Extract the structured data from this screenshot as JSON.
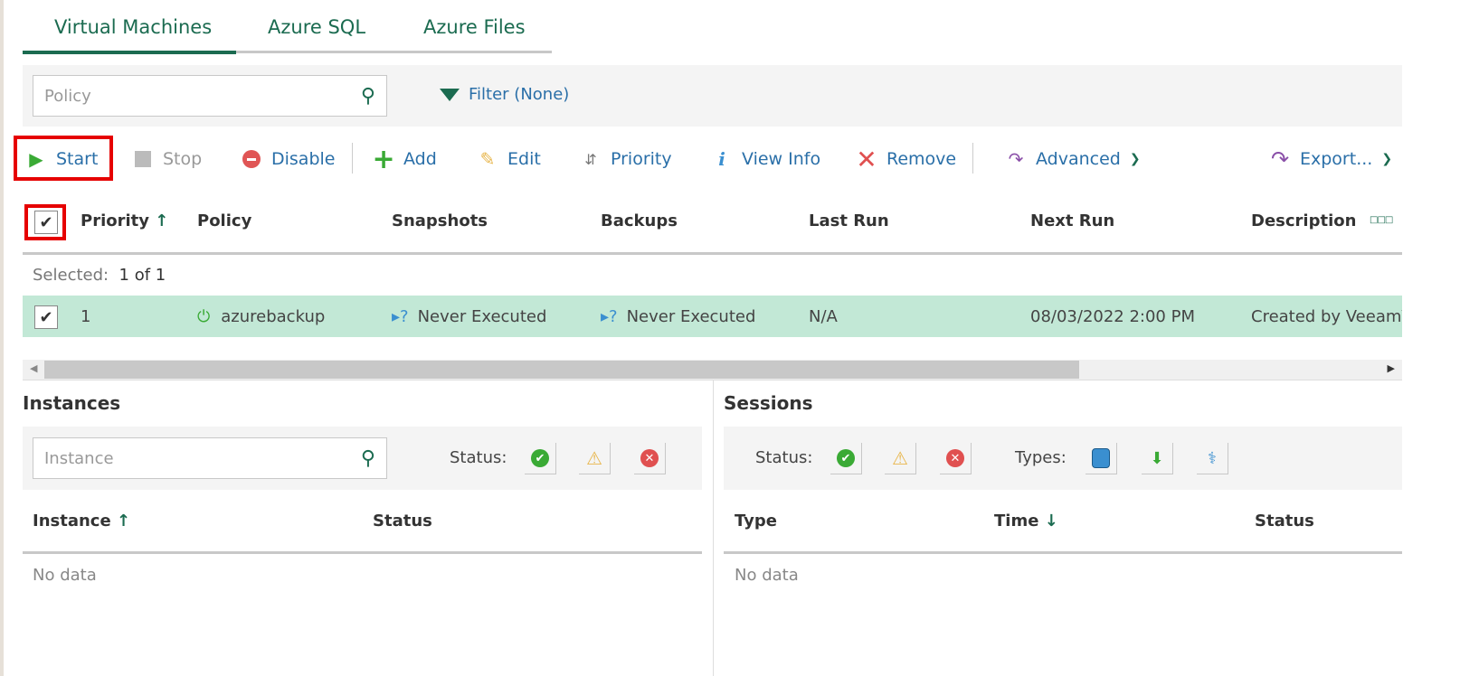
{
  "tabs": [
    {
      "label": "Virtual Machines",
      "active": true
    },
    {
      "label": "Azure SQL"
    },
    {
      "label": "Azure Files"
    }
  ],
  "search": {
    "placeholder": "Policy"
  },
  "filter": {
    "label": "Filter (None)"
  },
  "toolbar": {
    "start": "Start",
    "stop": "Stop",
    "disable": "Disable",
    "add": "Add",
    "edit": "Edit",
    "priority": "Priority",
    "view_info": "View Info",
    "remove": "Remove",
    "advanced": "Advanced",
    "export": "Export..."
  },
  "table": {
    "columns": [
      "Priority",
      "Policy",
      "Snapshots",
      "Backups",
      "Last Run",
      "Next Run",
      "Description"
    ],
    "selected_label": "Selected:",
    "selected_value": "1 of 1",
    "rows": [
      {
        "priority": "1",
        "policy": "azurebackup",
        "snapshots": "Never Executed",
        "backups": "Never Executed",
        "last_run": "N/A",
        "next_run": "08/03/2022 2:00 PM",
        "description": "Created by VeeamV"
      }
    ]
  },
  "instances": {
    "title": "Instances",
    "search_placeholder": "Instance",
    "status_label": "Status:",
    "columns": [
      "Instance",
      "Status"
    ],
    "empty": "No data"
  },
  "sessions": {
    "title": "Sessions",
    "status_label": "Status:",
    "types_label": "Types:",
    "columns": [
      "Type",
      "Time",
      "Status"
    ],
    "empty": "No data"
  },
  "colors": {
    "accent": "#1b6b50",
    "link": "#2a6fa8",
    "selected_row": "#c2e8d6",
    "highlight": "#e60000"
  }
}
